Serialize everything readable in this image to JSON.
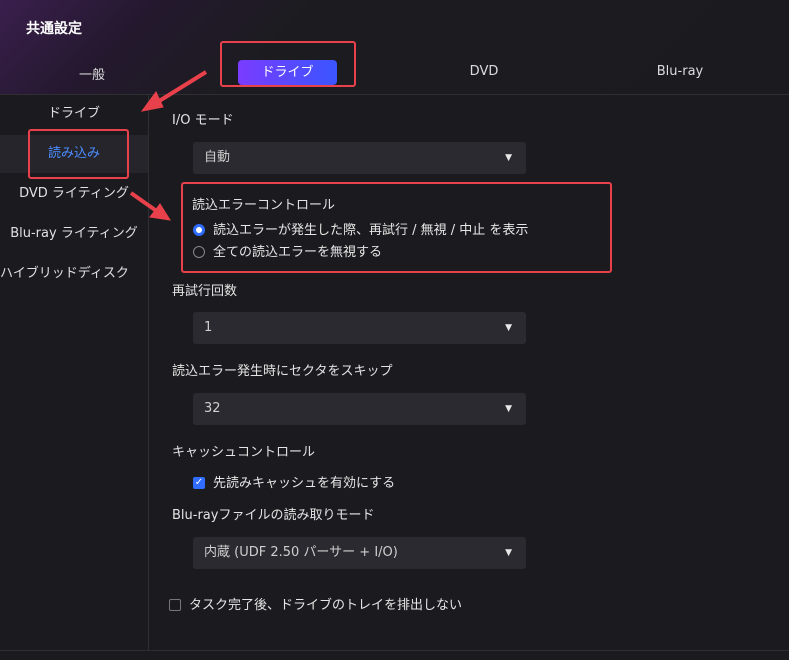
{
  "window": {
    "title": "共通設定"
  },
  "tabs": {
    "general": "一般",
    "drive": "ドライブ",
    "dvd": "DVD",
    "bluray": "Blu-ray"
  },
  "sidebar": {
    "items": [
      "ドライブ",
      "読み込み",
      "DVD ライティング",
      "Blu-ray ライティング",
      "ハイブリッドディスク"
    ],
    "active_index": 1
  },
  "settings": {
    "io_mode": {
      "label": "I/O モード",
      "value": "自動"
    },
    "read_error": {
      "label": "読込エラーコントロール",
      "options": [
        "読込エラーが発生した際、再試行 / 無視 / 中止 を表示",
        "全ての読込エラーを無視する"
      ],
      "selected_index": 0
    },
    "retry": {
      "label": "再試行回数",
      "value": "1"
    },
    "skip_sectors": {
      "label": "読込エラー発生時にセクタをスキップ",
      "value": "32"
    },
    "cache": {
      "label": "キャッシュコントロール",
      "checkbox_label": "先読みキャッシュを有効にする",
      "checked": true
    },
    "bluray_read_mode": {
      "label": "Blu-rayファイルの読み取りモード",
      "value": "内蔵 (UDF 2.50 パーサー + I/O)"
    },
    "tray": {
      "label": "タスク完了後、ドライブのトレイを排出しない",
      "checked": false
    }
  },
  "colors": {
    "accent": "#2f6cff",
    "annotation": "#e8414b",
    "background": "#1b1b1f",
    "field": "#2a2a30"
  }
}
